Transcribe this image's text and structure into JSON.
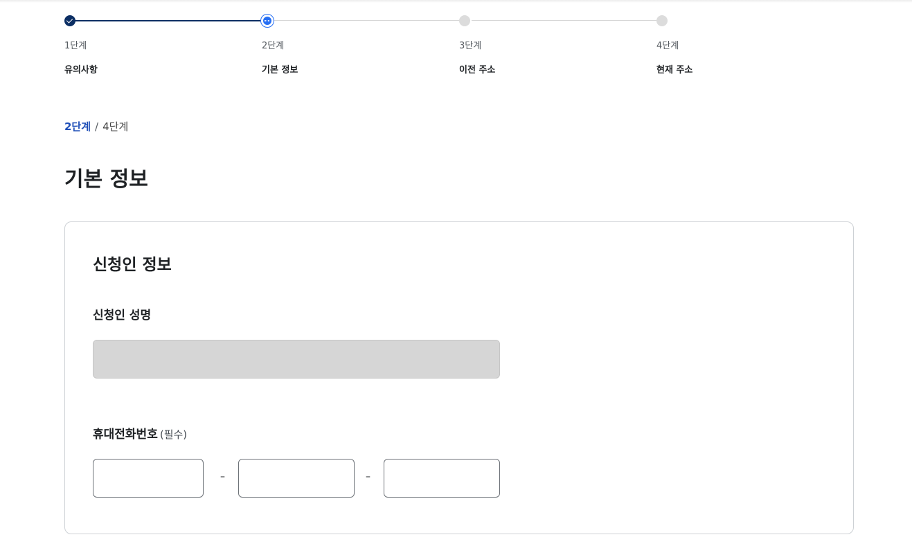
{
  "stepper": {
    "steps": [
      {
        "number": "1단계",
        "title": "유의사항",
        "state": "done"
      },
      {
        "number": "2단계",
        "title": "기본 정보",
        "state": "current"
      },
      {
        "number": "3단계",
        "title": "이전 주소",
        "state": "todo"
      },
      {
        "number": "4단계",
        "title": "현재 주소",
        "state": "todo"
      }
    ]
  },
  "progress": {
    "current": "2단계",
    "separator": "/",
    "total": "4단계"
  },
  "page_title": "기본 정보",
  "card": {
    "title": "신청인 정보",
    "name_field": {
      "label": "신청인 성명",
      "value": ""
    },
    "phone_field": {
      "label": "휴대전화번호",
      "required": "(필수)",
      "part1": "",
      "part2": "",
      "part3": "",
      "dash": "–"
    }
  },
  "colors": {
    "primary": "#0b2e63",
    "accent": "#256ef4",
    "counter": "#1f4fb8",
    "disabled_bg": "#d6d6d6"
  }
}
